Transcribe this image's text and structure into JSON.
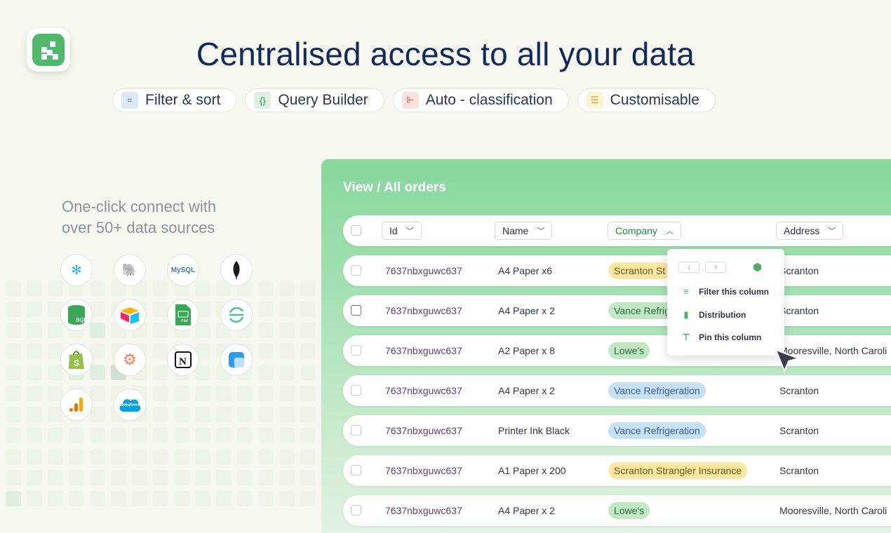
{
  "headline": "Centralised access to all your data",
  "features": [
    {
      "icon": "filter-icon",
      "label": "Filter & sort",
      "color": "#dce9f7"
    },
    {
      "icon": "braces-icon",
      "label": "Query Builder",
      "color": "#dff1e4"
    },
    {
      "icon": "tree-icon",
      "label": "Auto - classification",
      "color": "#fbe2e0"
    },
    {
      "icon": "sliders-icon",
      "label": "Customisable",
      "color": "#fbf4d6"
    }
  ],
  "connect": {
    "line1": "One-click connect with",
    "line2": "over 50+ data sources"
  },
  "sources": {
    "mysql": "MySQL",
    "sql": "SQL",
    "csv": "csv",
    "salesforce": "salesforce"
  },
  "panel": {
    "title": "View / All orders"
  },
  "columns": [
    "Id",
    "Name",
    "Company",
    "Address"
  ],
  "rows": [
    {
      "id": "7637nbxguwc637",
      "name": "A4 Paper x6",
      "company": "Scranton St",
      "address": "Scranton",
      "tag": "yellow"
    },
    {
      "id": "7637nbxguwc637",
      "name": "A4 Paper x 2",
      "company": "Vance Refrig",
      "address": "Scranton",
      "tag": "green"
    },
    {
      "id": "7637nbxguwc637",
      "name": "A2 Paper x 8",
      "company": "Lowe's",
      "address": "Mooresville, North Caroli",
      "tag": "green"
    },
    {
      "id": "7637nbxguwc637",
      "name": "A4 Paper x 2",
      "company": "Vance Refrigeration",
      "address": "Scranton",
      "tag": "blue"
    },
    {
      "id": "7637nbxguwc637",
      "name": "Printer Ink Black",
      "company": "Vance Refrigeration",
      "address": "Scranton",
      "tag": "blue"
    },
    {
      "id": "7637nbxguwc637",
      "name": "A1 Paper x 200",
      "company": "Scranton Strangler Insurance",
      "address": "Scranton",
      "tag": "yellow"
    },
    {
      "id": "7637nbxguwc637",
      "name": "A4 Paper x 2",
      "company": "Lowe's",
      "address": "Mooresville, North Caroli",
      "tag": "green"
    }
  ],
  "tag_colors": {
    "yellow": {
      "bg": "#fbe7a0",
      "fg": "#6b5718"
    },
    "green": {
      "bg": "#bfe8c3",
      "fg": "#2a6a36"
    },
    "blue": {
      "bg": "#c6e0f8",
      "fg": "#3a5f86"
    }
  },
  "dropdown": {
    "sort_desc": "↓",
    "sort_asc": "↑",
    "items": [
      "Filter this column",
      "Distribution",
      "Pin this column"
    ]
  }
}
